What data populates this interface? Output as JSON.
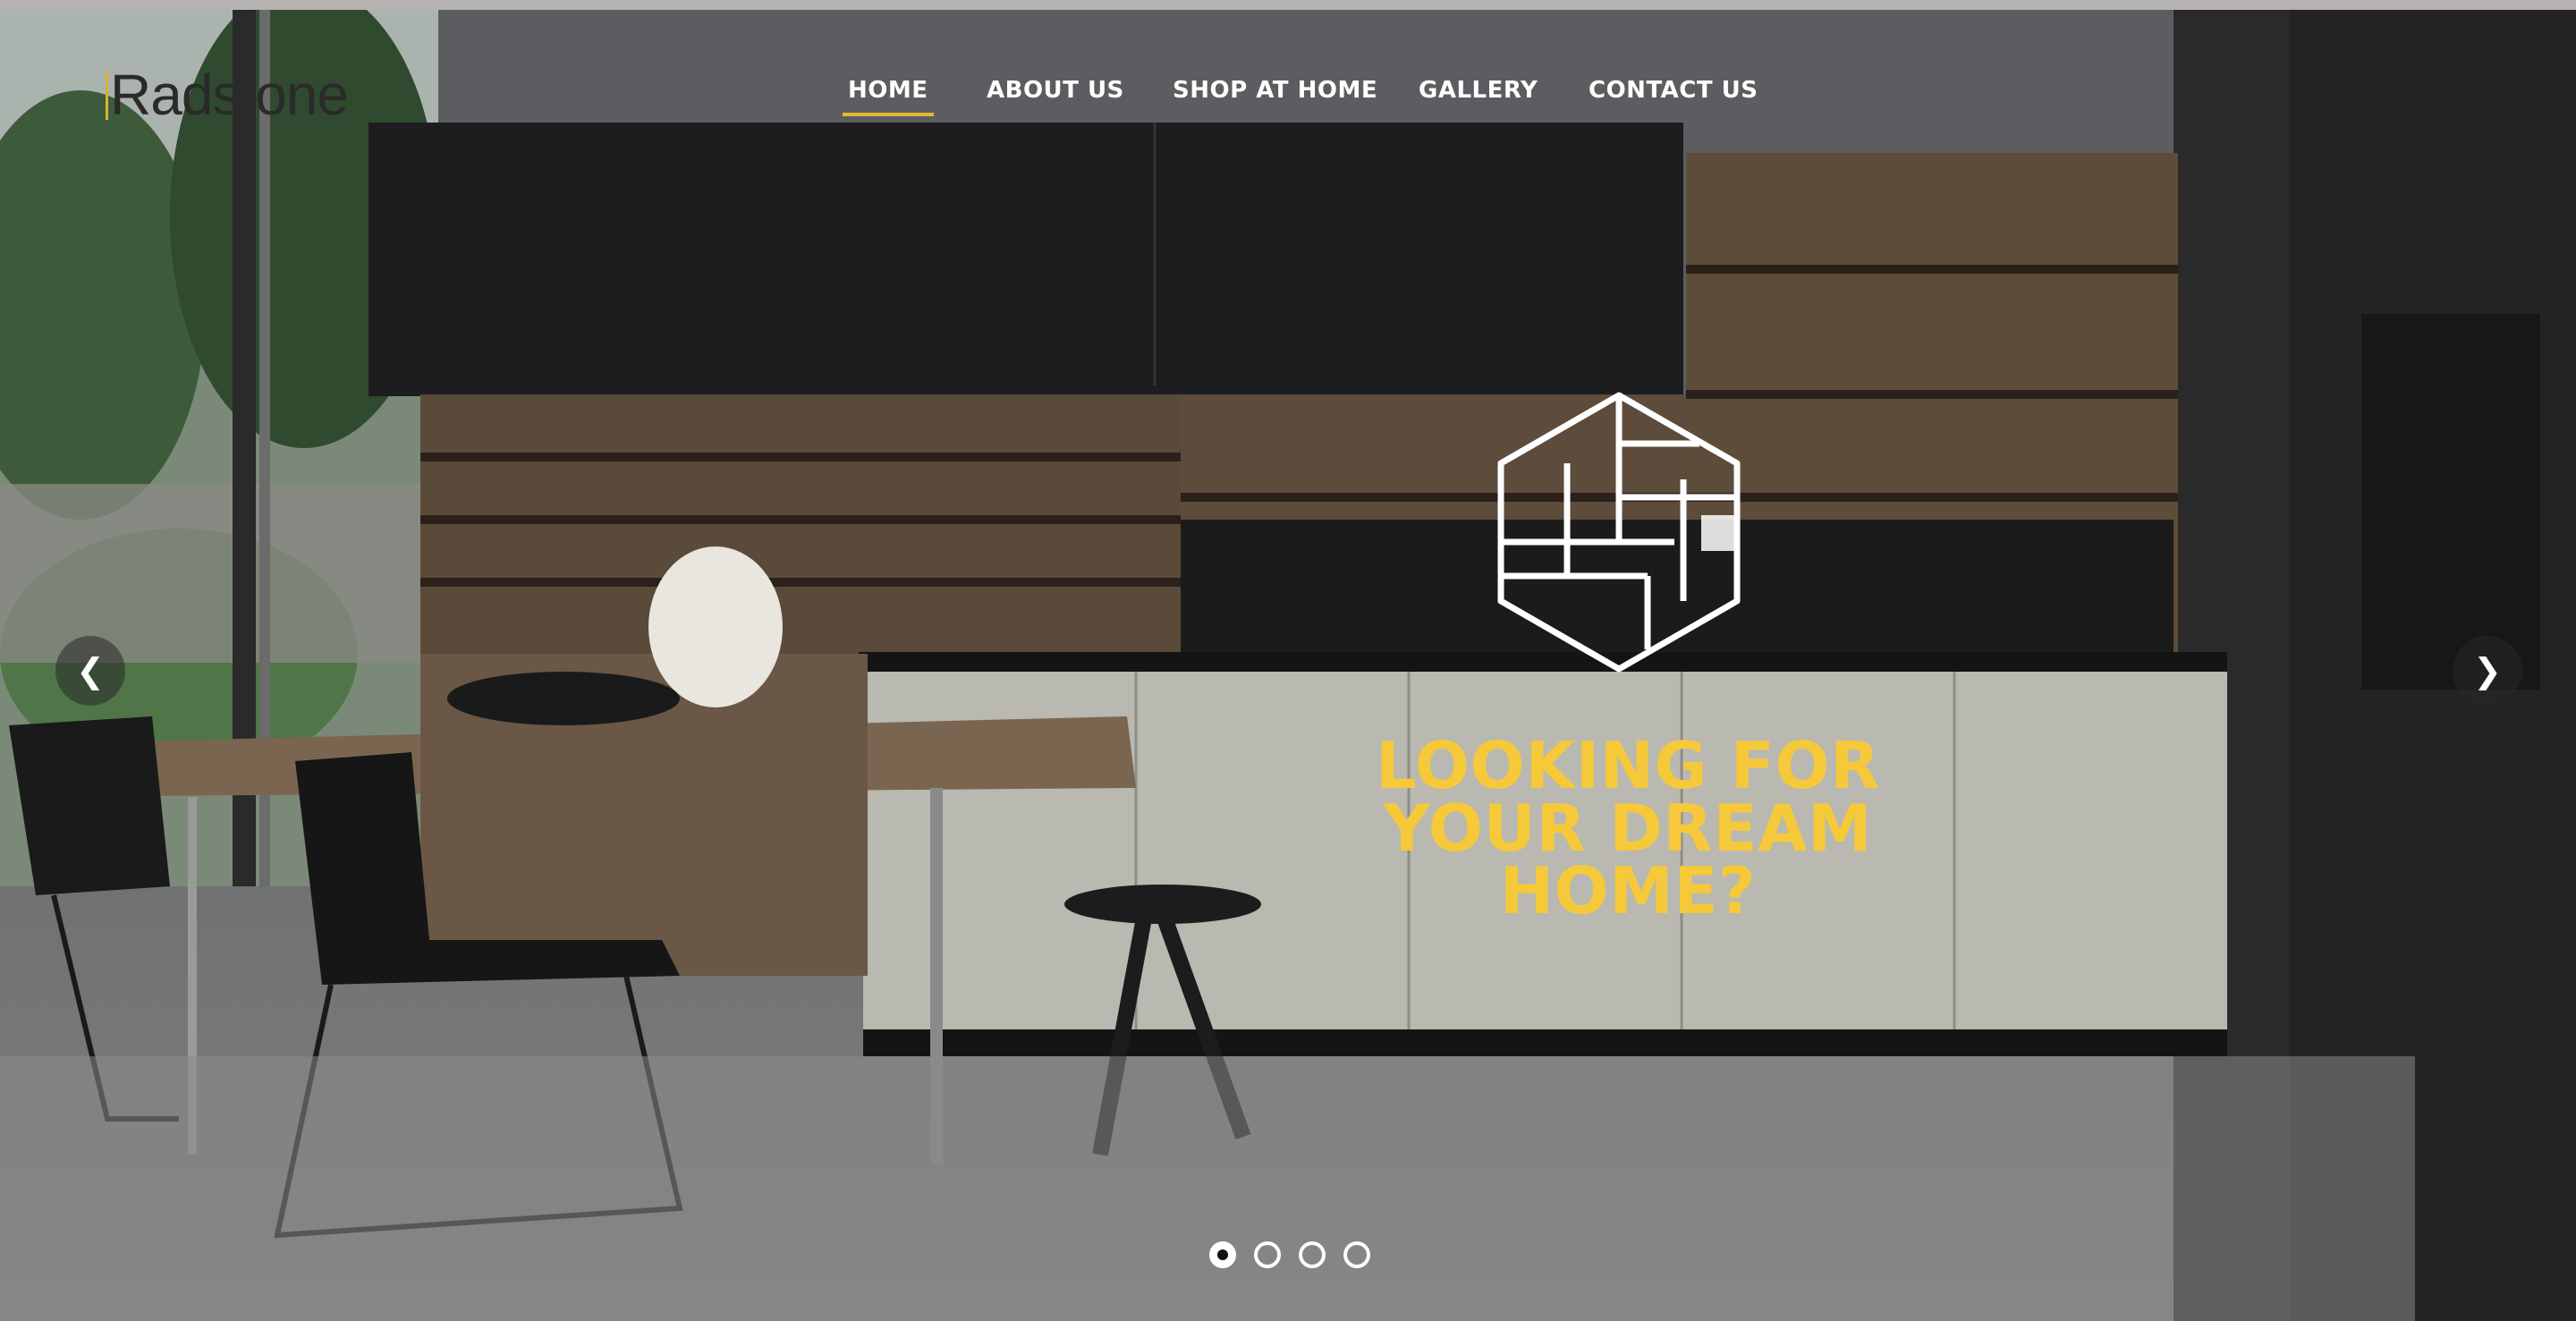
{
  "brand": {
    "logo_text": "Radstone",
    "accent": "#e3b92e"
  },
  "nav": {
    "items": [
      {
        "label": "HOME",
        "active": true
      },
      {
        "label": "ABOUT US",
        "active": false
      },
      {
        "label": "SHOP AT HOME",
        "active": false
      },
      {
        "label": "GALLERY",
        "active": false
      },
      {
        "label": "CONTACT US",
        "active": false
      }
    ]
  },
  "hero": {
    "headline_line1": "LOOKING FOR",
    "headline_line2": "YOUR DREAM",
    "headline_line3": "HOME?",
    "headline_color": "#f5c93a",
    "prev_icon": "chevron-left-icon",
    "next_icon": "chevron-right-icon",
    "emblem_icon": "cube-emblem-icon"
  },
  "carousel": {
    "slide_count": 4,
    "active_slide": 1
  }
}
